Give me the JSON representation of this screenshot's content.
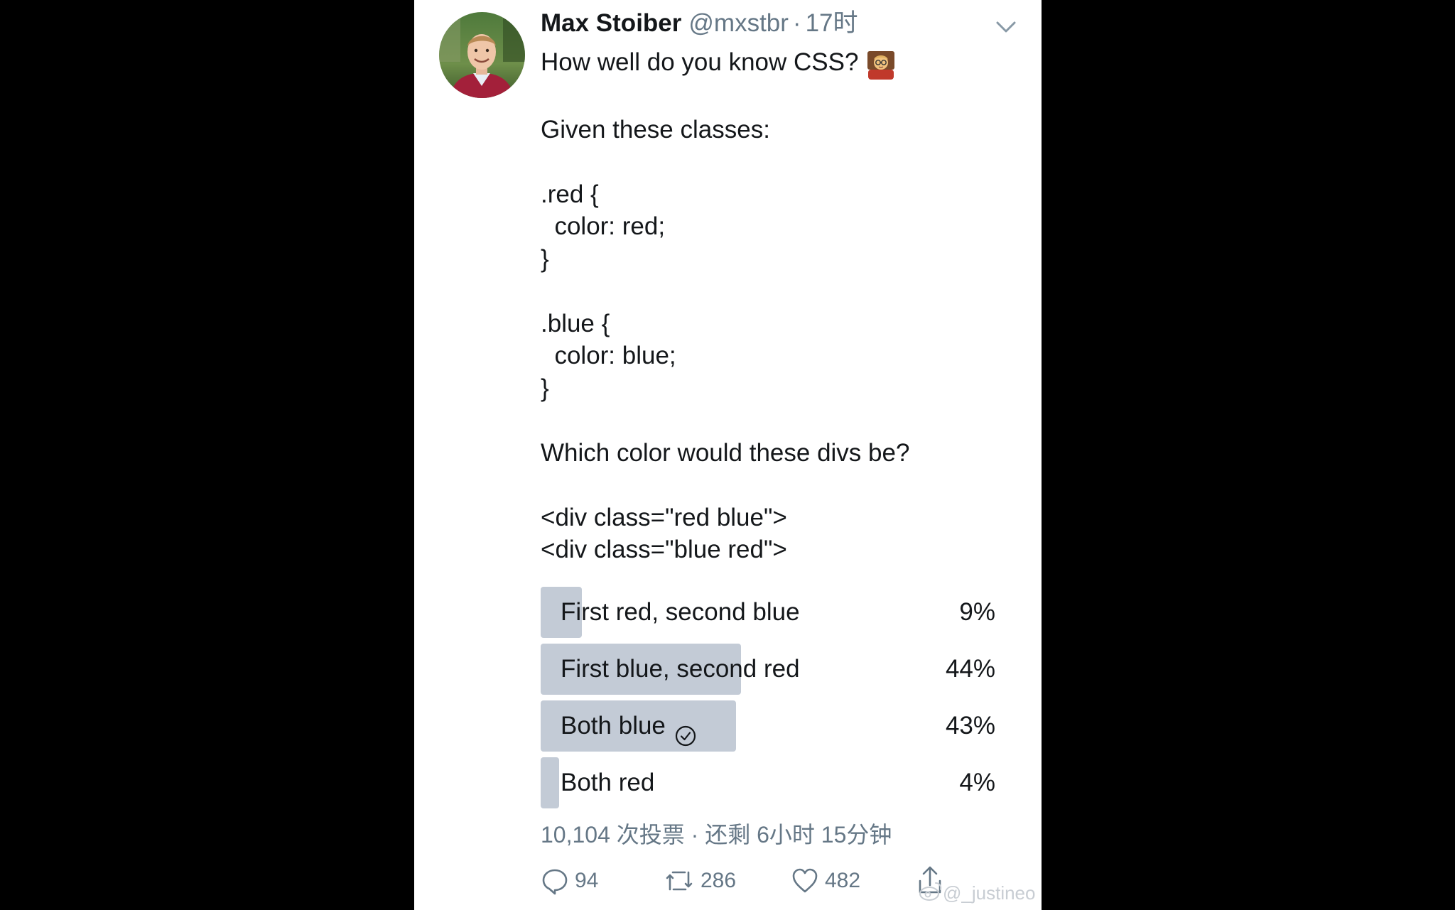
{
  "tweet": {
    "author_name": "Max Stoiber",
    "handle": "@mxstbr",
    "separator": "·",
    "time": "17时",
    "lines": [
      "How well do you know CSS?",
      "Given these classes:",
      ".red {",
      "  color: red;",
      "}",
      ".blue {",
      "  color: blue;",
      "}",
      "Which color would these divs be?",
      "<div class=\"red blue\">",
      "<div class=\"blue red\">"
    ],
    "emoji": "man-teacher-emoji"
  },
  "poll": {
    "options": [
      {
        "label": "First red, second blue",
        "percent_text": "9%",
        "percent": 9,
        "selected": false
      },
      {
        "label": "First blue, second red",
        "percent_text": "44%",
        "percent": 44,
        "selected": false
      },
      {
        "label": "Both blue",
        "percent_text": "43%",
        "percent": 43,
        "selected": true
      },
      {
        "label": "Both red",
        "percent_text": "4%",
        "percent": 4,
        "selected": false
      }
    ],
    "summary": "10,104 次投票 · 还剩 6小时 15分钟"
  },
  "actions": {
    "reply_count": "94",
    "retweet_count": "286",
    "like_count": "482"
  },
  "watermark": {
    "text": "@_justineo"
  },
  "colors": {
    "background": "#000000",
    "card": "#ffffff",
    "poll_bar": "#c3cbd6",
    "text": "#14171a",
    "muted": "#657786"
  }
}
